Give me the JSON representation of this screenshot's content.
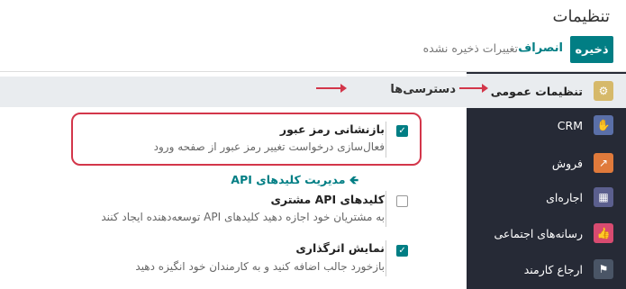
{
  "header": {
    "title": "تنظیمات",
    "save_label": "ذخیره",
    "discard_label": "انصراف",
    "unsaved_label": "تغییرات ذخیره نشده"
  },
  "sidebar": {
    "items": [
      {
        "label": "تنظیمات عمومی",
        "icon": "gear-icon",
        "color": "#d6b96a"
      },
      {
        "label": "CRM",
        "icon": "handshake-icon",
        "color": "#5a6fa8"
      },
      {
        "label": "فروش",
        "icon": "chart-icon",
        "color": "#e07a3b"
      },
      {
        "label": "اجاره‌ای",
        "icon": "rental-icon",
        "color": "#5b5f8e"
      },
      {
        "label": "رسانه‌های اجتماعی",
        "icon": "thumbs-up-icon",
        "color": "#d84b70"
      },
      {
        "label": "ارجاع کارمند",
        "icon": "people-icon",
        "color": "#4a5566"
      }
    ]
  },
  "section": {
    "title": "دسترسی‌ها"
  },
  "settings": {
    "password_reset": {
      "title": "بازنشانی رمز عبور",
      "description": "فعال‌سازی درخواست تغییر رمز عبور از صفحه ورود",
      "checked": true
    },
    "api_link": "مدیریت کلیدهای API",
    "api_keys": {
      "title": "کلیدهای API مشتری",
      "description": "به مشتریان خود اجازه دهید کلیدهای API توسعه‌دهنده ایجاد کنند",
      "checked": false
    },
    "impact": {
      "title": "نمایش اثرگذاری",
      "description": "بازخورد جالب اضافه کنید و به کارمندان خود انگیزه دهید",
      "checked": true
    }
  },
  "colors": {
    "accent": "#017e84",
    "sidebar_bg": "#262a36",
    "annotation": "#d3364a"
  }
}
